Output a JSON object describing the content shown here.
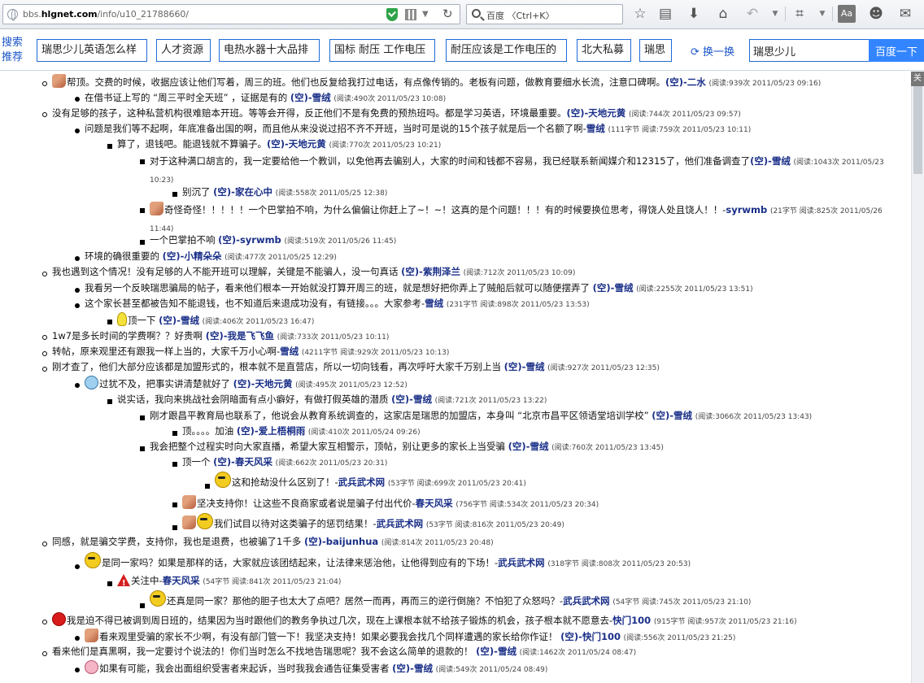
{
  "browser": {
    "url_prefix": "bbs.",
    "url_domain": "hlgnet.com",
    "url_path": "/info/u10_21788660/",
    "search_placeholder": "百度 〈Ctrl+K〉"
  },
  "baidu_bar": {
    "label": "搜索推荐",
    "keywords": [
      "瑞思少儿英语怎么样",
      "人才资源",
      "电热水器十大品排",
      "国标 耐压 工作电压",
      "耐压应该是工作电压的",
      "北大私募",
      "瑞思"
    ],
    "refresh_label": "换一换",
    "input_value": "瑞思少儿",
    "button_label": "百度一下"
  },
  "side_tab": "关",
  "posts": [
    {
      "text": "帮顶。交费的时候，收据应该让他们写着，周三的班。他们也反复给我打过电话，有点像传销的。老板有问题，做教育要细水长流，注意口碑啊。",
      "author": "(空)-二水",
      "meta": "(阅读:939次 2011/05/23 09:16)"
    },
    {
      "text": "在借书证上写的 “周三平时全天班” ，证据是有的 ",
      "author": "(空)-雪绒",
      "meta": "(阅读:490次 2011/05/23 10:08)"
    },
    {
      "text": "没有足够的孩子，这种私营机构很难赔本开班。等等会开得，反正他们不是有免费的预热班吗。都是学习英语，环境最重要。",
      "author": "(空)-天地元黄",
      "meta": "(阅读:744次 2011/05/23 09:57)"
    },
    {
      "text": "问题是我们等不起啊，年底准备出国的啊，而且他从来没说过招不齐不开班，当时可是说的15个孩子就是后一个名额了啊-",
      "author": "雪绒",
      "meta": "(111字节 阅读:759次 2011/05/23 10:11)"
    },
    {
      "text": "算了，退钱吧。能退钱就不算骗子。",
      "author": "(空)-天地元黄",
      "meta": "(阅读:770次 2011/05/23 10:21)"
    },
    {
      "text": "对于这种满口胡言的，我一定要给他一个教训，以免他再去骗别人，大家的时间和钱都不容易，我已经联系新闻媒介和12315了，他们准备调查了",
      "author": "(空)-雪绒",
      "meta": "(阅读:1043次 2011/05/23 10:23)"
    },
    {
      "text": "别沉了 ",
      "author": "(空)-家在心中",
      "meta": "(阅读:558次 2011/05/25 12:38)"
    },
    {
      "text": "奇怪奇怪！！！！！一个巴掌拍不响，为什么偏偏让你赶上了~！~！这真的是个问题！！！有的时候要换位思考，得饶人处且饶人！！-",
      "author": "syrwmb",
      "meta": "(21字节 阅读:825次 2011/05/26 11:44)"
    },
    {
      "text": "一个巴掌拍不响 ",
      "author": "(空)-syrwmb",
      "meta": "(阅读:519次 2011/05/26 11:45)"
    },
    {
      "text": "环境的确很重要的 ",
      "author": "(空)-小精朵朵",
      "meta": "(阅读:477次 2011/05/25 12:29)"
    },
    {
      "text": "我也遇到这个情况！没有足够的人不能开班可以理解，关键是不能骗人，没一句真话 ",
      "author": "(空)-紫荆泽兰",
      "meta": "(阅读:712次 2011/05/23 10:09)"
    },
    {
      "text": "我看另一个反映瑞思骗局的帖子，看来他们根本一开始就没打算开周三的班，就是想好把你弄上了贼船后就可以随便摆弄了 ",
      "author": "(空)-雪绒",
      "meta": "(阅读:2255次 2011/05/23 13:51)"
    },
    {
      "text": "这个家长甚至都被告知不能退钱，也不知道后来退成功没有，有链接。。。大家参考-",
      "author": "雪绒",
      "meta": "(231字节 阅读:898次 2011/05/23 13:53)"
    },
    {
      "text": "顶一下 ",
      "author": "(空)-雪绒",
      "meta": "(阅读:406次 2011/05/23 16:47)"
    },
    {
      "text": "1w7是多长时间的学费啊？？好贵啊 ",
      "author": "(空)-我是飞飞鱼",
      "meta": "(阅读:733次 2011/05/23 10:11)"
    },
    {
      "text": "转帖，原来观里还有跟我一样上当的，大家千万小心啊-",
      "author": "雪绒",
      "meta": "(4211字节 阅读:929次 2011/05/23 10:13)"
    },
    {
      "text": "刚才查了，他们大部分应该都是加盟形式的，根本就不是直营店，所以一切向钱看，再次呼吁大家千万别上当 ",
      "author": "(空)-雪绒",
      "meta": "(阅读:927次 2011/05/23 12:35)"
    },
    {
      "text": "过犹不及，把事实讲清楚就好了 ",
      "author": "(空)-天地元黄",
      "meta": "(阅读:495次 2011/05/23 12:52)"
    },
    {
      "text": "说实话，我向来挑战社会阴暗面有点小癖好，有做打假英雄的潜质 ",
      "author": "(空)-雪绒",
      "meta": "(阅读:721次 2011/05/23 13:22)"
    },
    {
      "text": "刚才跟昌平教育局也联系了，他说会从教育系统调查的，这家店是瑞思的加盟店，本身叫 “北京市昌平区领语堂培训学校” ",
      "author": "(空)-雪绒",
      "meta": "(阅读:3066次 2011/05/23 13:43)"
    },
    {
      "text": "顶。。。。加油 ",
      "author": "(空)-爱上梧桐雨",
      "meta": "(阅读:410次 2011/05/24 09:26)"
    },
    {
      "text": "我会把整个过程实时向大家直播，希望大家互相警示，顶帖，别让更多的家长上当受骗 ",
      "author": "(空)-雪绒",
      "meta": "(阅读:760次 2011/05/23 13:45)"
    },
    {
      "text": "顶一个 ",
      "author": "(空)-春天风采",
      "meta": "(阅读:662次 2011/05/23 20:31)"
    },
    {
      "text": "这和抢劫没什么区别了！-",
      "author": "武兵武术网",
      "meta": "(53字节 阅读:699次 2011/05/23 20:41)"
    },
    {
      "text": "坚决支持你！让这些不良商家或者说是骗子付出代价-",
      "author": "春天风采",
      "meta": "(756字节 阅读:534次 2011/05/23 20:34)"
    },
    {
      "text": "我们试目以待对这类骗子的惩罚结果！-",
      "author": "武兵武术网",
      "meta": "(53字节 阅读:816次 2011/05/23 20:49)"
    },
    {
      "text": "同感，就是骗交学费，支持你，我也是退费，也被骗了1千多 ",
      "author": "(空)-baijunhua",
      "meta": "(阅读:814次 2011/05/23 20:48)"
    },
    {
      "text": "是同一家吗？如果是那样的话，大家就应该团结起来，让法律来惩治他，让他得到应有的下场！-",
      "author": "武兵武术网",
      "meta": "(318字节 阅读:808次 2011/05/23 20:53)"
    },
    {
      "text": "关注中-",
      "author": "春天风采",
      "meta": "(54字节 阅读:841次 2011/05/23 21:04)"
    },
    {
      "text": "还真是同一家？那他的胆子也太大了点吧？居然一而再，再而三的逆行倒施？不怕犯了众怒吗？-",
      "author": "武兵武术网",
      "meta": "(54字节 阅读:745次 2011/05/23 21:10)"
    },
    {
      "text": "我是迫不得已被调到周日班的，结果因为当时跟他们的教务争执过几次，现在上课根本就不给孩子锻炼的机会，孩子根本就不愿意去-",
      "author": "快门100",
      "meta": "(915字节 阅读:957次 2011/05/23 21:16)"
    },
    {
      "text": "看来观里受骗的家长不少啊，有没有部门管一下！我坚决支持！如果必要我会找几个同样遭遇的家长给你作证！ ",
      "author": "(空)-快门100",
      "meta": "(阅读:556次 2011/05/23 21:25)"
    },
    {
      "text": "看来他们是真黑啊，我一定要讨个说法的！你们当时怎么不找地告瑞思呢？我不会这么简单的退款的！ ",
      "author": "(空)-雪绒",
      "meta": "(阅读:1462次 2011/05/24 08:47)"
    },
    {
      "text": "如果有可能，我会出面组织受害者来起诉，当时我我会通告征集受害者 ",
      "author": "(空)-雪绒",
      "meta": "(阅读:549次 2011/05/24 08:49)"
    }
  ]
}
